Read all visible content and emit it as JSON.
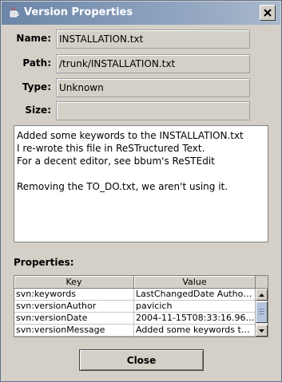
{
  "window": {
    "title": "Version Properties",
    "icon": "java-cup-icon",
    "close_icon": "close-x-icon"
  },
  "fields": {
    "name_label": "Name:",
    "name_value": "INSTALLATION.txt",
    "path_label": "Path:",
    "path_value": "/trunk/INSTALLATION.txt",
    "type_label": "Type:",
    "type_value": "Unknown",
    "size_label": "Size:",
    "size_value": ""
  },
  "notes": {
    "lines": [
      "Added some keywords to the INSTALLATION.txt",
      "I re-wrote this file in ReSTructured Text.",
      "For a decent editor, see bbum's ReSTEdit",
      "",
      "Removing the TO_DO.txt, we aren't using it."
    ]
  },
  "properties": {
    "label": "Properties:",
    "columns": [
      "Key",
      "Value"
    ],
    "rows": [
      [
        "svn:keywords",
        "LastChangedDate Author ..."
      ],
      [
        "svn:versionAuthor",
        "pavicich"
      ],
      [
        "svn:versionDate",
        "2004-11-15T08:33:16.967..."
      ],
      [
        "svn:versionMessage",
        "Added some keywords to t..."
      ]
    ]
  },
  "footer": {
    "close_label": "Close"
  },
  "colors": {
    "titlebar": "#6b85a8",
    "background": "#d4d0c8"
  }
}
